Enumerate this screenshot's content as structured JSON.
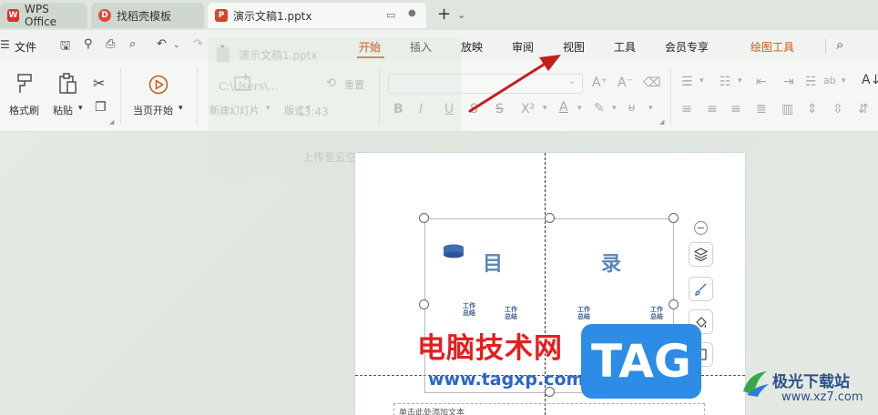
{
  "tabs": [
    {
      "label": "WPS Office",
      "logo": "W"
    },
    {
      "label": "找稻壳模板",
      "logo": "D"
    },
    {
      "label": "演示文稿1.pptx",
      "logo": "P"
    }
  ],
  "app_menu_label": "文件",
  "menu": [
    "开始",
    "插入",
    "放映",
    "审阅",
    "视图",
    "工具",
    "会员专享",
    "绘图工具"
  ],
  "active_menu": "开始",
  "ribbon": {
    "format_painter": "格式刷",
    "paste": "粘贴",
    "from_current": "当页开始",
    "new_slide": "新建幻灯片",
    "layout": "版式",
    "reset": "重置"
  },
  "ghost": {
    "file": "演示文稿1.pptx",
    "path": "C:\\Users\\...",
    "time": "13:43",
    "upload": "上传至云空间"
  },
  "slide": {
    "title_left": "目",
    "title_right": "录",
    "item_labels": [
      "工作\n总结",
      "工作\n总结",
      "工作\n总结",
      "工作\n总结"
    ],
    "placeholder": "单击此处添加文本"
  },
  "watermark": {
    "cn": "电脑技术网",
    "url": "www.tagxp.com",
    "tag": "TAG",
    "site": "极光下载站",
    "domain": "www.xz7.com"
  },
  "colors": {
    "accent": "#c45a1a",
    "arrow": "#c41e1e",
    "tag_blue": "#2c8ce6"
  }
}
